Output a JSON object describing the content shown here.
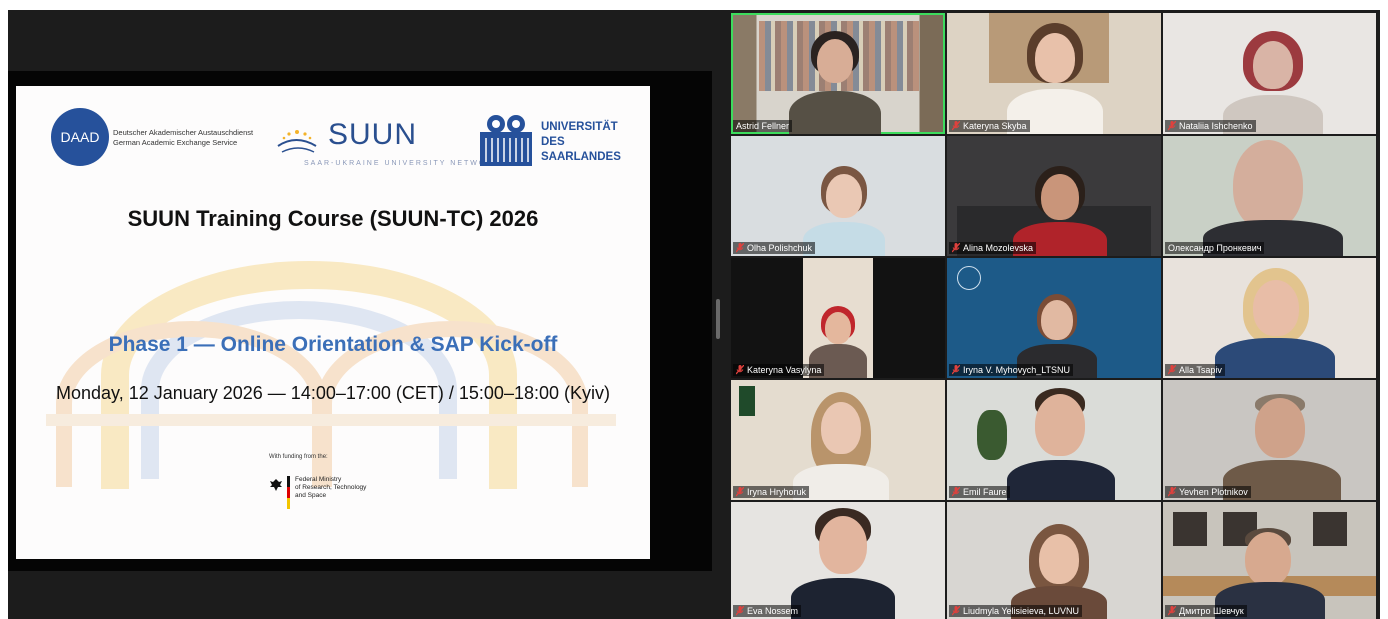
{
  "slide": {
    "daad_abbr": "DAAD",
    "daad_line1": "Deutscher Akademischer Austauschdienst",
    "daad_line2": "German Academic Exchange Service",
    "suun_word": "SUUN",
    "suun_sub": "SAAR-UKRAINE UNIVERSITY NETWORK",
    "uds_line1": "UNIVERSITÄT",
    "uds_line2": "DES",
    "uds_line3": "SAARLANDES",
    "title": "SUUN Training Course (SUUN-TC) 2026",
    "phase": "Phase 1 — Online Orientation & SAP Kick-off",
    "date": "Monday, 12 January 2026 — 14:00–17:00 (CET) / 15:00–18:00 (Kyiv)",
    "funding": "With funding from the:",
    "ministry_line1": "Federal Ministry",
    "ministry_line2": "of Research, Technology",
    "ministry_line3": "and Space"
  },
  "toolbar_icons": [
    "arrow-left-icon",
    "pen-icon",
    "zoom-icon",
    "captions-icon",
    "camera-icon",
    "more-icon",
    "arrow-right-icon"
  ],
  "participants": [
    {
      "name": "Astrid Fellner",
      "muted": false,
      "active": true
    },
    {
      "name": "Kateryna Skyba",
      "muted": true
    },
    {
      "name": "Nataliia Ishchenko",
      "muted": true
    },
    {
      "name": "Olha Polishchuk",
      "muted": true
    },
    {
      "name": "Alina Mozolevska",
      "muted": true
    },
    {
      "name": "Олександр Пронкевич",
      "muted": false
    },
    {
      "name": "Kateryna Vasylyna",
      "muted": true
    },
    {
      "name": "Iryna V. Myhovych_LTSNU",
      "muted": true
    },
    {
      "name": "Alla Tsapiv",
      "muted": true
    },
    {
      "name": "Iryna Hryhoruk",
      "muted": true
    },
    {
      "name": "Emil Faure",
      "muted": true
    },
    {
      "name": "Yevhen Plotnikov",
      "muted": true
    },
    {
      "name": "Eva Nossem",
      "muted": true
    },
    {
      "name": "Liudmyla Yelisieieva, LUVNU",
      "muted": true
    },
    {
      "name": "Дмитро Шевчук",
      "muted": true
    }
  ],
  "colors": {
    "active_border": "#3ddc5d",
    "muted_icon": "#e0413d",
    "brand_blue": "#26519b"
  }
}
